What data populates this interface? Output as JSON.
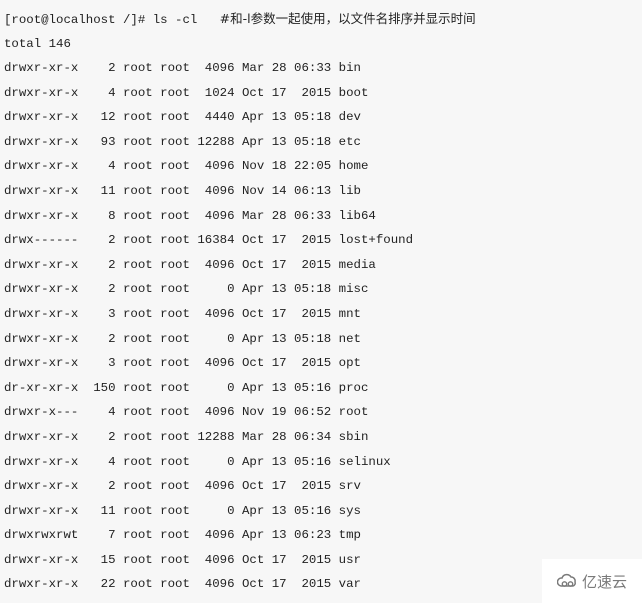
{
  "terminal": {
    "prompt": "[root@localhost /]# ",
    "command": "ls -cl   ",
    "comment": "#和-l参数一起使用，以文件名排序并显示时间",
    "total": "total 146",
    "entries": [
      {
        "perms": "drwxr-xr-x",
        "links": "2",
        "owner": "root",
        "group": "root",
        "size": "4096",
        "month": "Mar",
        "day": "28",
        "time": "06:33",
        "name": "bin"
      },
      {
        "perms": "drwxr-xr-x",
        "links": "4",
        "owner": "root",
        "group": "root",
        "size": "1024",
        "month": "Oct",
        "day": "17",
        "time": "2015",
        "name": "boot"
      },
      {
        "perms": "drwxr-xr-x",
        "links": "12",
        "owner": "root",
        "group": "root",
        "size": "4440",
        "month": "Apr",
        "day": "13",
        "time": "05:18",
        "name": "dev"
      },
      {
        "perms": "drwxr-xr-x",
        "links": "93",
        "owner": "root",
        "group": "root",
        "size": "12288",
        "month": "Apr",
        "day": "13",
        "time": "05:18",
        "name": "etc"
      },
      {
        "perms": "drwxr-xr-x",
        "links": "4",
        "owner": "root",
        "group": "root",
        "size": "4096",
        "month": "Nov",
        "day": "18",
        "time": "22:05",
        "name": "home"
      },
      {
        "perms": "drwxr-xr-x",
        "links": "11",
        "owner": "root",
        "group": "root",
        "size": "4096",
        "month": "Nov",
        "day": "14",
        "time": "06:13",
        "name": "lib"
      },
      {
        "perms": "drwxr-xr-x",
        "links": "8",
        "owner": "root",
        "group": "root",
        "size": "4096",
        "month": "Mar",
        "day": "28",
        "time": "06:33",
        "name": "lib64"
      },
      {
        "perms": "drwx------",
        "links": "2",
        "owner": "root",
        "group": "root",
        "size": "16384",
        "month": "Oct",
        "day": "17",
        "time": "2015",
        "name": "lost+found"
      },
      {
        "perms": "drwxr-xr-x",
        "links": "2",
        "owner": "root",
        "group": "root",
        "size": "4096",
        "month": "Oct",
        "day": "17",
        "time": "2015",
        "name": "media"
      },
      {
        "perms": "drwxr-xr-x",
        "links": "2",
        "owner": "root",
        "group": "root",
        "size": "0",
        "month": "Apr",
        "day": "13",
        "time": "05:18",
        "name": "misc"
      },
      {
        "perms": "drwxr-xr-x",
        "links": "3",
        "owner": "root",
        "group": "root",
        "size": "4096",
        "month": "Oct",
        "day": "17",
        "time": "2015",
        "name": "mnt"
      },
      {
        "perms": "drwxr-xr-x",
        "links": "2",
        "owner": "root",
        "group": "root",
        "size": "0",
        "month": "Apr",
        "day": "13",
        "time": "05:18",
        "name": "net"
      },
      {
        "perms": "drwxr-xr-x",
        "links": "3",
        "owner": "root",
        "group": "root",
        "size": "4096",
        "month": "Oct",
        "day": "17",
        "time": "2015",
        "name": "opt"
      },
      {
        "perms": "dr-xr-xr-x",
        "links": "150",
        "owner": "root",
        "group": "root",
        "size": "0",
        "month": "Apr",
        "day": "13",
        "time": "05:16",
        "name": "proc"
      },
      {
        "perms": "drwxr-x---",
        "links": "4",
        "owner": "root",
        "group": "root",
        "size": "4096",
        "month": "Nov",
        "day": "19",
        "time": "06:52",
        "name": "root"
      },
      {
        "perms": "drwxr-xr-x",
        "links": "2",
        "owner": "root",
        "group": "root",
        "size": "12288",
        "month": "Mar",
        "day": "28",
        "time": "06:34",
        "name": "sbin"
      },
      {
        "perms": "drwxr-xr-x",
        "links": "4",
        "owner": "root",
        "group": "root",
        "size": "0",
        "month": "Apr",
        "day": "13",
        "time": "05:16",
        "name": "selinux"
      },
      {
        "perms": "drwxr-xr-x",
        "links": "2",
        "owner": "root",
        "group": "root",
        "size": "4096",
        "month": "Oct",
        "day": "17",
        "time": "2015",
        "name": "srv"
      },
      {
        "perms": "drwxr-xr-x",
        "links": "11",
        "owner": "root",
        "group": "root",
        "size": "0",
        "month": "Apr",
        "day": "13",
        "time": "05:16",
        "name": "sys"
      },
      {
        "perms": "drwxrwxrwt",
        "links": "7",
        "owner": "root",
        "group": "root",
        "size": "4096",
        "month": "Apr",
        "day": "13",
        "time": "06:23",
        "name": "tmp"
      },
      {
        "perms": "drwxr-xr-x",
        "links": "15",
        "owner": "root",
        "group": "root",
        "size": "4096",
        "month": "Oct",
        "day": "17",
        "time": "2015",
        "name": "usr"
      },
      {
        "perms": "drwxr-xr-x",
        "links": "22",
        "owner": "root",
        "group": "root",
        "size": "4096",
        "month": "Oct",
        "day": "17",
        "time": "2015",
        "name": "var"
      }
    ]
  },
  "watermark": {
    "icon": "cloud-icon",
    "text": "亿速云"
  }
}
